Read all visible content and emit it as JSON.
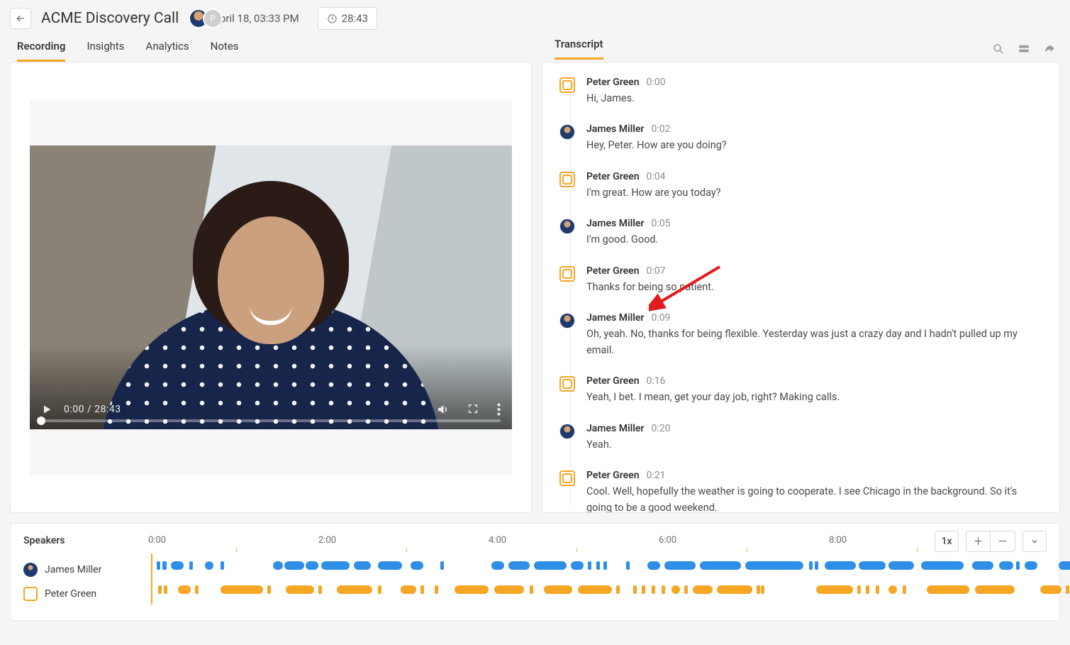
{
  "header": {
    "title": "ACME Discovery Call",
    "date": "April 18, 03:33 PM",
    "duration": "28:43",
    "participant_initial": "P"
  },
  "tabs": {
    "recording": "Recording",
    "insights": "Insights",
    "analytics": "Analytics",
    "notes": "Notes"
  },
  "transcript_label": "Transcript",
  "video": {
    "current": "0:00",
    "total": "28:43"
  },
  "transcript": [
    {
      "speaker": "Peter Green",
      "who": "peter",
      "time": "0:00",
      "text": "Hi, James."
    },
    {
      "speaker": "James Miller",
      "who": "james",
      "time": "0:02",
      "text": "Hey, Peter. How are you doing?"
    },
    {
      "speaker": "Peter Green",
      "who": "peter",
      "time": "0:04",
      "text": "I'm great. How are you today?"
    },
    {
      "speaker": "James Miller",
      "who": "james",
      "time": "0:05",
      "text": "I'm good. Good."
    },
    {
      "speaker": "Peter Green",
      "who": "peter",
      "time": "0:07",
      "text": "Thanks for being so patient."
    },
    {
      "speaker": "James Miller",
      "who": "james",
      "time": "0:09",
      "text": "Oh, yeah. No, thanks for being flexible. Yesterday was just a crazy day and I hadn't pulled up my email."
    },
    {
      "speaker": "Peter Green",
      "who": "peter",
      "time": "0:16",
      "text": "Yeah, I bet. I mean, get your day job, right? Making calls."
    },
    {
      "speaker": "James Miller",
      "who": "james",
      "time": "0:20",
      "text": "Yeah."
    },
    {
      "speaker": "Peter Green",
      "who": "peter",
      "time": "0:21",
      "text": "Cool. Well, hopefully the weather is going to cooperate. I see Chicago in the background. So it's going to be a good weekend."
    }
  ],
  "timeline": {
    "speakers_title": "Speakers",
    "speaker_james": "James Miller",
    "speaker_peter": "Peter Green",
    "ticks": [
      "0:00",
      "2:00",
      "4:00",
      "6:00",
      "8:00"
    ],
    "zoom_label": "1x"
  }
}
